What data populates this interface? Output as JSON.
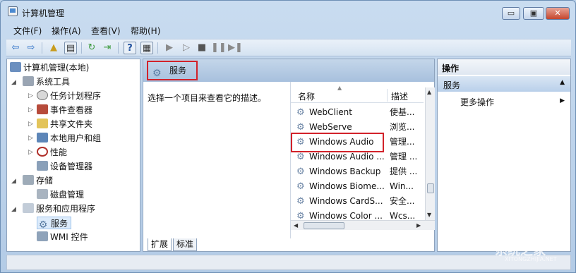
{
  "window": {
    "title": "计算机管理",
    "min": "▭",
    "max": "▣",
    "close": "✕"
  },
  "menus": [
    "文件(F)",
    "操作(A)",
    "查看(V)",
    "帮助(H)"
  ],
  "tree": {
    "root": "计算机管理(本地)",
    "system_tools": "系统工具",
    "task_scheduler": "任务计划程序",
    "event_viewer": "事件查看器",
    "shared_folders": "共享文件夹",
    "local_users": "本地用户和组",
    "performance": "性能",
    "device_manager": "设备管理器",
    "storage": "存储",
    "disk_management": "磁盘管理",
    "services_apps": "服务和应用程序",
    "services": "服务",
    "wmi": "WMI 控件"
  },
  "services": {
    "title": "服务",
    "description": "选择一个项目来查看它的描述。",
    "col_name": "名称",
    "col_desc": "描述",
    "rows": [
      {
        "name": "WebClient",
        "desc": "使基..."
      },
      {
        "name": "WebServe",
        "desc": "浏览..."
      },
      {
        "name": "Windows Audio",
        "desc": "管理..."
      },
      {
        "name": "Windows Audio ...",
        "desc": "管理 ..."
      },
      {
        "name": "Windows Backup",
        "desc": "提供 ..."
      },
      {
        "name": "Windows Biome...",
        "desc": "Win..."
      },
      {
        "name": "Windows CardS...",
        "desc": "安全..."
      },
      {
        "name": "Windows Color ...",
        "desc": "Wcs..."
      }
    ],
    "tabs": [
      "扩展",
      "标准"
    ]
  },
  "actions": {
    "header": "操作",
    "section": "服务",
    "more": "更多操作"
  },
  "watermark": {
    "main": "系统之家",
    "sub": "XITONGZHIJIA.NET"
  },
  "colors": {
    "highlight": "#d2222a",
    "accent": "#2f6fc2"
  }
}
